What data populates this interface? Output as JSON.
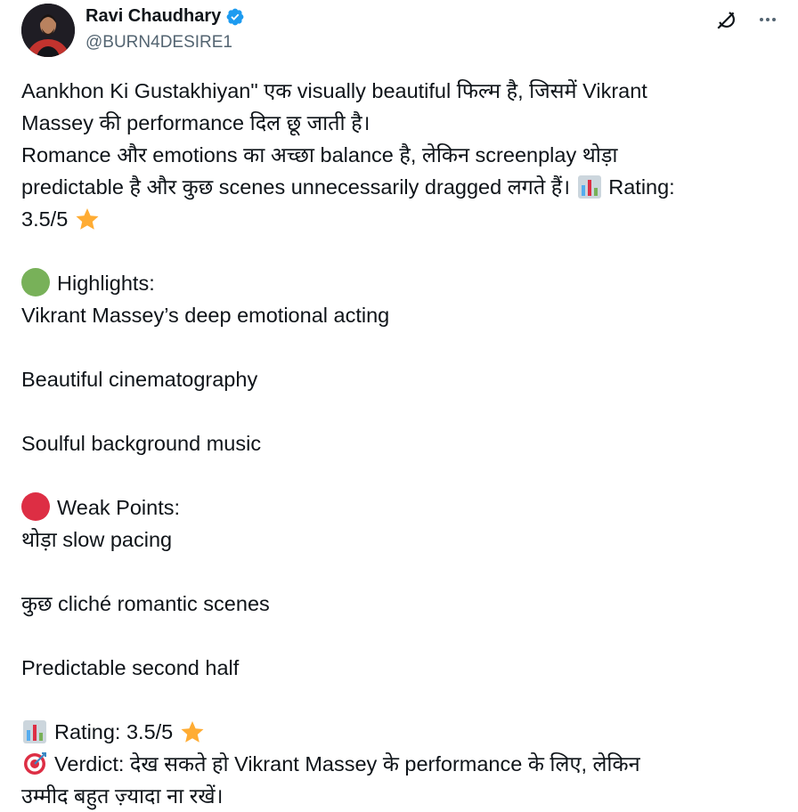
{
  "author": {
    "display_name": "Ravi Chaudhary",
    "handle": "@BURN4DESIRE1",
    "verified": true
  },
  "icons": {
    "verified": "verified-badge-icon",
    "grok": "grok-icon",
    "more": "more-icon",
    "chart": "bar-chart-icon",
    "star": "star-icon",
    "green_circle": "green-circle-icon",
    "red_circle": "red-circle-icon",
    "target": "direct-hit-icon"
  },
  "colors": {
    "verified_blue": "#1d9bf0",
    "text": "#0f1419",
    "secondary": "#536471",
    "green": "#78b159",
    "red": "#dd2e44",
    "star": "#ffac33"
  },
  "post": {
    "intro_line1": "Aankhon Ki Gustakhiyan\" एक visually beautiful फिल्म है, जिसमें Vikrant",
    "intro_line2": "Massey की performance दिल छू जाती है।",
    "intro_line3": "Romance और emotions का अच्छा balance है, लेकिन screenplay थोड़ा",
    "intro_line4_a": "predictable है और कुछ scenes unnecessarily dragged लगते हैं।",
    "intro_line4_b": "Rating:",
    "intro_line5": "3.5/5",
    "highlights_heading": "Highlights:",
    "highlights": [
      "Vikrant Massey’s deep emotional acting",
      "Beautiful cinematography",
      "Soulful background music"
    ],
    "weak_heading": "Weak Points:",
    "weak_points": [
      "थोड़ा slow pacing",
      "कुछ cliché romantic scenes",
      "Predictable second half"
    ],
    "rating_line": "Rating: 3.5/5",
    "verdict_line1": "Verdict: देख सकते हो Vikrant Massey के performance के लिए, लेकिन",
    "verdict_line2": "उम्मीद बहुत ज़्यादा ना रखें।"
  }
}
